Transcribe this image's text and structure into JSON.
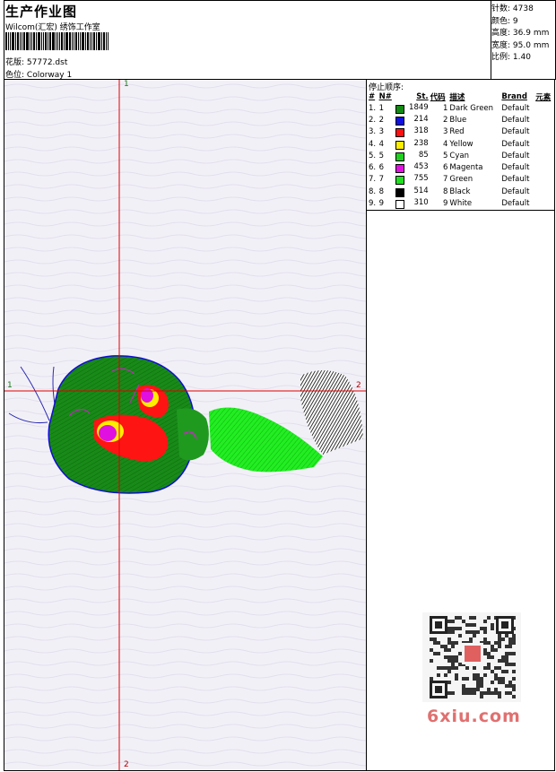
{
  "header": {
    "title": "生产作业图",
    "company": "Wilcom(汇宏) 绣饰工作室",
    "design_label": "花版:",
    "design_file": "57772.dst",
    "colorway_label": "色位:",
    "colorway": "Colorway 1"
  },
  "stats": {
    "stitches_label": "针数:",
    "stitches": "4738",
    "colors_label": "颜色:",
    "colors": "9",
    "height_label": "高度:",
    "height": "36.9 mm",
    "width_label": "宽度:",
    "width": "95.0 mm",
    "scale_label": "比例:",
    "scale": "1.40"
  },
  "sequence": {
    "title": "停止顺序:",
    "headers": [
      "#",
      "N#",
      "St.",
      "代码",
      "描述",
      "Brand",
      "元素"
    ],
    "rows": [
      {
        "idx": "1.",
        "n": "1",
        "color": "#138a13",
        "st": "1849",
        "code": "1",
        "desc": "Dark Green",
        "brand": "Default"
      },
      {
        "idx": "2.",
        "n": "2",
        "color": "#1010e0",
        "st": "214",
        "code": "2",
        "desc": "Blue",
        "brand": "Default"
      },
      {
        "idx": "3.",
        "n": "3",
        "color": "#ff1010",
        "st": "318",
        "code": "3",
        "desc": "Red",
        "brand": "Default"
      },
      {
        "idx": "4.",
        "n": "4",
        "color": "#ffee00",
        "st": "238",
        "code": "4",
        "desc": "Yellow",
        "brand": "Default"
      },
      {
        "idx": "5.",
        "n": "5",
        "color": "#20d020",
        "st": "85",
        "code": "5",
        "desc": "Cyan",
        "brand": "Default"
      },
      {
        "idx": "6.",
        "n": "6",
        "color": "#e010e0",
        "st": "453",
        "code": "6",
        "desc": "Magenta",
        "brand": "Default"
      },
      {
        "idx": "7.",
        "n": "7",
        "color": "#20e020",
        "st": "755",
        "code": "7",
        "desc": "Green",
        "brand": "Default"
      },
      {
        "idx": "8.",
        "n": "8",
        "color": "#000000",
        "st": "514",
        "code": "8",
        "desc": "Black",
        "brand": "Default"
      },
      {
        "idx": "9.",
        "n": "9",
        "color": "#ffffff",
        "st": "310",
        "code": "9",
        "desc": "White",
        "brand": "Default"
      }
    ]
  },
  "axes": {
    "top": "1",
    "bottom": "2",
    "left": "1",
    "right": "2"
  },
  "watermark": {
    "text": "6xiu.com"
  }
}
